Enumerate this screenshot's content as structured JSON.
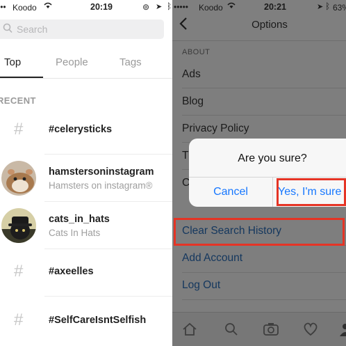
{
  "left": {
    "status": {
      "carrier": "Koodo",
      "time": "20:19"
    },
    "search": {
      "placeholder": "Search"
    },
    "tabs": [
      "Top",
      "People",
      "Tags"
    ],
    "section": "RECENT",
    "items": [
      {
        "type": "hashtag",
        "title": "#celerysticks"
      },
      {
        "type": "account",
        "title": "hamstersoninstagram",
        "subtitle": "Hamsters on instagram®"
      },
      {
        "type": "account",
        "title": "cats_in_hats",
        "subtitle": "Cats In Hats"
      },
      {
        "type": "hashtag",
        "title": "#axeelles"
      },
      {
        "type": "hashtag",
        "title": "#SelfCareIsntSelfish"
      }
    ]
  },
  "right": {
    "status": {
      "carrier": "Koodo",
      "time": "20:21",
      "battery": "63"
    },
    "header": {
      "title": "Options"
    },
    "section": "ABOUT",
    "items": [
      "Ads",
      "Blog",
      "Privacy Policy",
      "T",
      "C"
    ],
    "actions": [
      "Clear Search History",
      "Add Account",
      "Log Out"
    ]
  },
  "dialog": {
    "title": "Are you sure?",
    "cancel": "Cancel",
    "confirm": "Yes, I'm sure"
  },
  "colors": {
    "highlight": "#e53425",
    "link": "#1677ff"
  }
}
